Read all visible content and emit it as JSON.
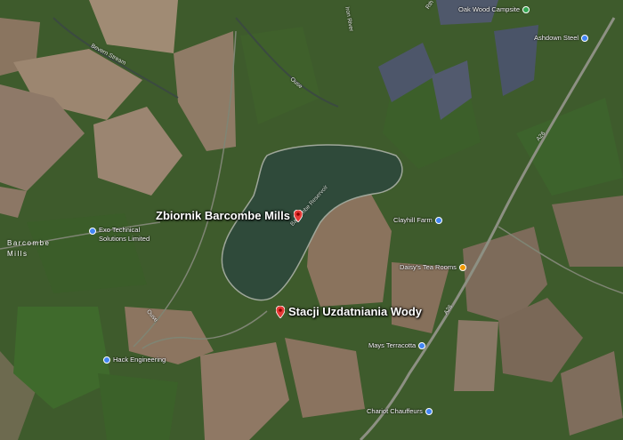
{
  "markers": {
    "reservoir_title": "Zbiornik Barcombe Mills",
    "station_title": "Stacji Uzdatniania Wody",
    "marker_color": "#e53935"
  },
  "pois": {
    "oak_wood": "Oak Wood Campsite",
    "ashdown": "Ashdown Steel",
    "exo_line1": "Exo Technical",
    "exo_line2": "Solutions Limited",
    "clayhill": "Clayhill Farm",
    "daisy": "Daisy's Tea Rooms",
    "mays": "Mays Terracotta",
    "hack": "Hack Engineering",
    "chariot": "Chariot Chauffeurs"
  },
  "places": {
    "village_line1": "Barcombe",
    "village_line2": "Mills"
  },
  "features": {
    "reservoir": "Barcombe Reservoir",
    "bevern": "Bevern Stream",
    "ouse_north": "Ouse",
    "ouse_south": "Ouse",
    "iron_river": "Iron River",
    "road_a26_north": "A26",
    "road_a26_south": "A26",
    "top_road": "Rth"
  },
  "colors": {
    "green_pin": "#34a853",
    "blue_pin": "#4285f4",
    "orange_pin": "#f29900"
  }
}
